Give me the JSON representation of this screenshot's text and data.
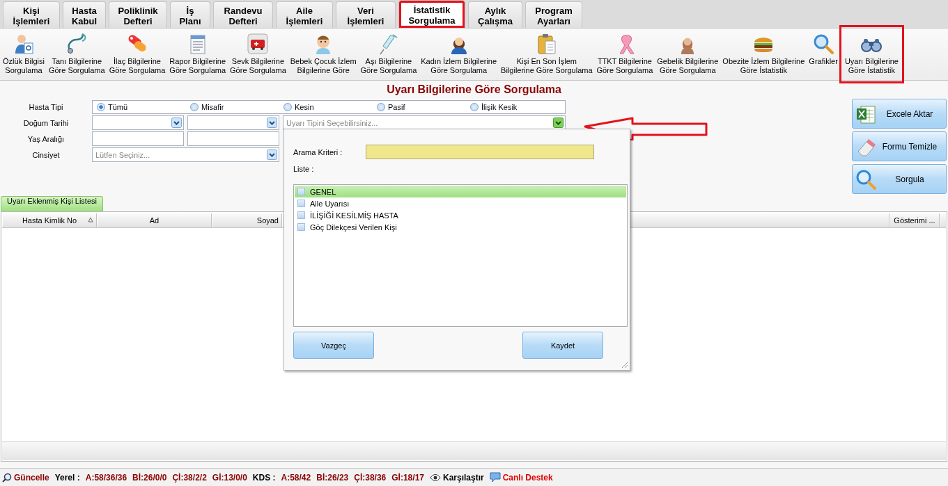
{
  "tabs": [
    {
      "label": "Kişi\nİşlemleri",
      "selected": false,
      "highlighted": false
    },
    {
      "label": "Hasta\nKabul",
      "selected": false,
      "highlighted": false
    },
    {
      "label": "Poliklinik\nDefteri",
      "selected": false,
      "highlighted": false
    },
    {
      "label": "İş\nPlanı",
      "selected": false,
      "highlighted": false
    },
    {
      "label": "Randevu\nDefteri",
      "selected": false,
      "highlighted": false
    },
    {
      "label": "Aile\nİşlemleri",
      "selected": false,
      "highlighted": false
    },
    {
      "label": "Veri\nİşlemleri",
      "selected": false,
      "highlighted": false
    },
    {
      "label": "İstatistik\nSorgulama",
      "selected": true,
      "highlighted": true
    },
    {
      "label": "Aylık\nÇalışma",
      "selected": false,
      "highlighted": false
    },
    {
      "label": "Program\nAyarları",
      "selected": false,
      "highlighted": false
    }
  ],
  "toolbar": [
    {
      "label": "Özlük Bilgisi\nSorgulama",
      "highlighted": false
    },
    {
      "label": "Tanı Bilgilerine\nGöre Sorgulama",
      "highlighted": false
    },
    {
      "label": "İlaç Bilgilerine\nGöre Sorgulama",
      "highlighted": false
    },
    {
      "label": "Rapor Bilgilerine\nGöre Sorgulama",
      "highlighted": false
    },
    {
      "label": "Sevk Bilgilerine\nGöre Sorgulama",
      "highlighted": false
    },
    {
      "label": "Bebek Çocuk İzlem\nBilgilerine Göre",
      "highlighted": false
    },
    {
      "label": "Aşı Bilgilerine\nGöre Sorgulama",
      "highlighted": false
    },
    {
      "label": "Kadın İzlem Bilgilerine\nGöre Sorgulama",
      "highlighted": false
    },
    {
      "label": "Kişi En Son İşlem\nBilgilerine Göre Sorgulama",
      "highlighted": false
    },
    {
      "label": "TTKT Bilgilerine\nGöre Sorgulama",
      "highlighted": false
    },
    {
      "label": "Gebelik Bilgilerine\nGöre Sorgulama",
      "highlighted": false
    },
    {
      "label": "Obezite İzlem Bilgilerine\nGöre İstatistik",
      "highlighted": false
    },
    {
      "label": "Grafikler",
      "highlighted": false
    },
    {
      "label": "Uyarı Bilgilerine\nGöre İstatistik",
      "highlighted": true
    }
  ],
  "title": "Uyarı Bilgilerine Göre Sorgulama",
  "form": {
    "patient_type": {
      "label": "Hasta Tipi",
      "options": [
        {
          "label": "Tümü",
          "selected": true
        },
        {
          "label": "Misafir",
          "selected": false
        },
        {
          "label": "Kesin",
          "selected": false
        },
        {
          "label": "Pasif",
          "selected": false
        },
        {
          "label": "İlişik Kesik",
          "selected": false
        }
      ]
    },
    "birth_date": {
      "label": "Doğum Tarihi"
    },
    "warning_type": {
      "placeholder": "Uyarı Tipini Seçebilirsiniz..."
    },
    "age_range": {
      "label": "Yaş Aralığı"
    },
    "gender": {
      "label": "Cinsiyet",
      "placeholder": "Lütfen Seçiniz..."
    }
  },
  "actions": [
    {
      "label": "Excele Aktar"
    },
    {
      "label": "Formu Temizle"
    },
    {
      "label": "Sorgula"
    }
  ],
  "grid": {
    "tab": {
      "label": "Uyarı Eklenmiş Kişi Listesi",
      "selected": true
    },
    "columns": [
      {
        "label": "Hasta Kimlik No",
        "sorted": true
      },
      {
        "label": "Ad",
        "sorted": false
      },
      {
        "label": "Soyad",
        "sorted": false
      },
      {
        "label": "Gösterimi ...",
        "sorted": false
      }
    ]
  },
  "popup": {
    "search_label": "Arama Kriteri :",
    "list_label": "Liste :",
    "items": [
      {
        "label": "GENEL",
        "checked": false,
        "selected": true
      },
      {
        "label": "Aile Uyarısı",
        "checked": false,
        "selected": false
      },
      {
        "label": "İLİŞİĞİ KESİLMİŞ HASTA",
        "checked": false,
        "selected": false
      },
      {
        "label": "Göç Dilekçesi Verilen Kişi",
        "checked": false,
        "selected": false
      }
    ],
    "cancel": "Vazgeç",
    "save": "Kaydet"
  },
  "status_bar": {
    "update": "Güncelle",
    "local_label": "Yerel :",
    "local_counts": [
      "A:58/36/36",
      "Bİ:26/0/0",
      "Çİ:38/2/2",
      "Gİ:13/0/0"
    ],
    "kds_label": "KDS :",
    "kds_counts": [
      "A:58/42",
      "Bİ:26/23",
      "Çİ:38/36",
      "Gİ:18/17"
    ],
    "compare": "Karşılaştır",
    "support": "Canlı Destek"
  }
}
